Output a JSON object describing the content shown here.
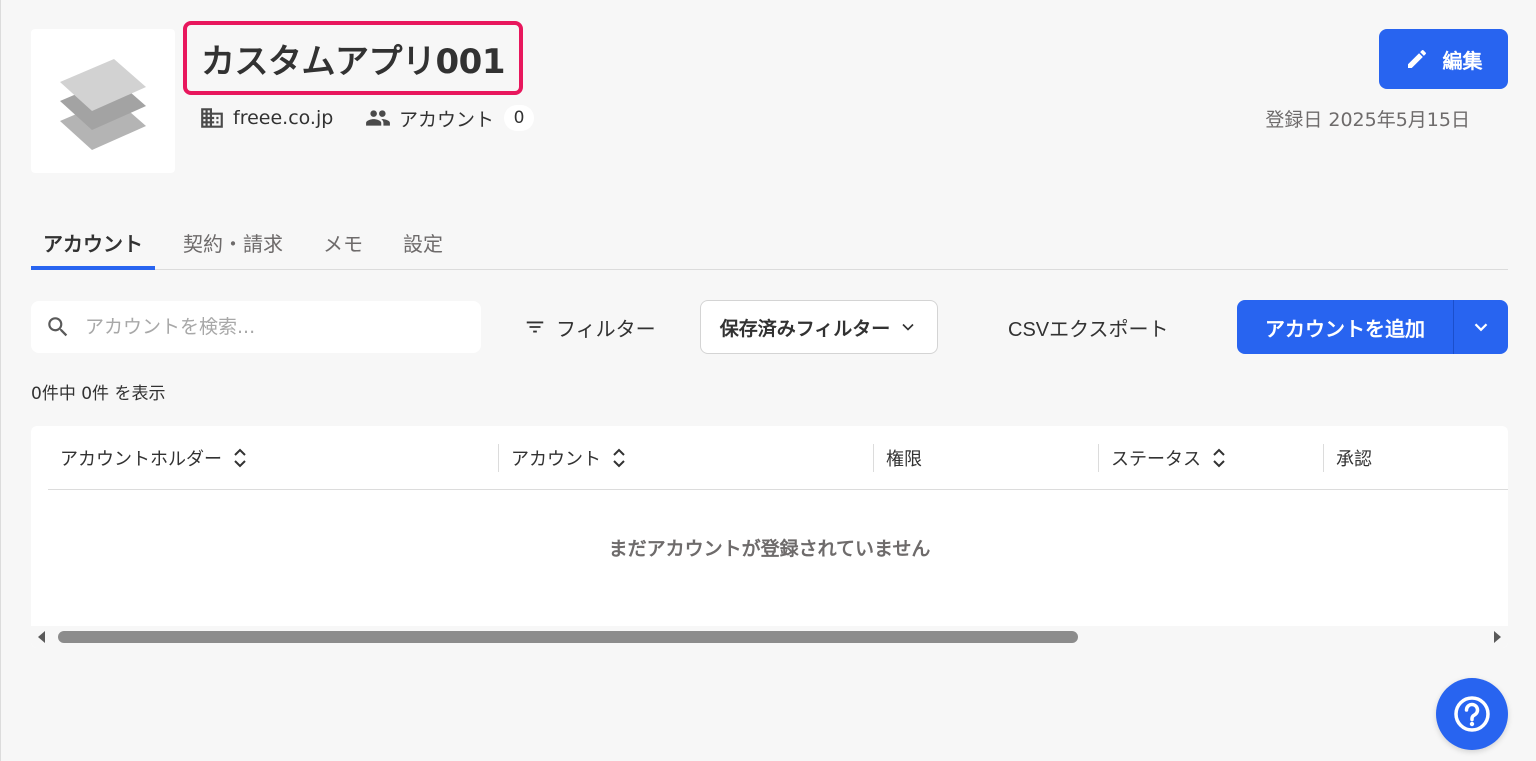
{
  "app": {
    "title": "カスタムアプリ001",
    "domain": "freee.co.jp",
    "accounts_label": "アカウント",
    "accounts_count": "0",
    "edit_label": "編集",
    "registered_date": "登録日 2025年5月15日"
  },
  "tabs": [
    {
      "label": "アカウント",
      "active": true
    },
    {
      "label": "契約・請求",
      "active": false
    },
    {
      "label": "メモ",
      "active": false
    },
    {
      "label": "設定",
      "active": false
    }
  ],
  "toolbar": {
    "search_placeholder": "アカウントを検索...",
    "filter_label": "フィルター",
    "saved_filter_label": "保存済みフィルター",
    "csv_export_label": "CSVエクスポート",
    "add_account_label": "アカウントを追加"
  },
  "result_count": "0件中 0件 を表示",
  "table": {
    "columns": [
      {
        "label": "アカウントホルダー",
        "sortable": true
      },
      {
        "label": "アカウント",
        "sortable": true
      },
      {
        "label": "権限",
        "sortable": false
      },
      {
        "label": "ステータス",
        "sortable": true
      },
      {
        "label": "承認",
        "sortable": false
      }
    ],
    "empty_message": "まだアカウントが登録されていません",
    "scroll_position": 0
  },
  "icons": {
    "logo": "layers-logo-icon",
    "domain": "building-icon",
    "accounts": "people-icon",
    "edit": "pencil-icon",
    "search": "search-icon",
    "filter": "filter-icon",
    "dropdown": "chevron-down-icon",
    "sort": "sort-icon",
    "help": "help-icon"
  },
  "colors": {
    "primary": "#2864f0",
    "highlight_border": "#e8175d",
    "background": "#f7f7f7"
  }
}
